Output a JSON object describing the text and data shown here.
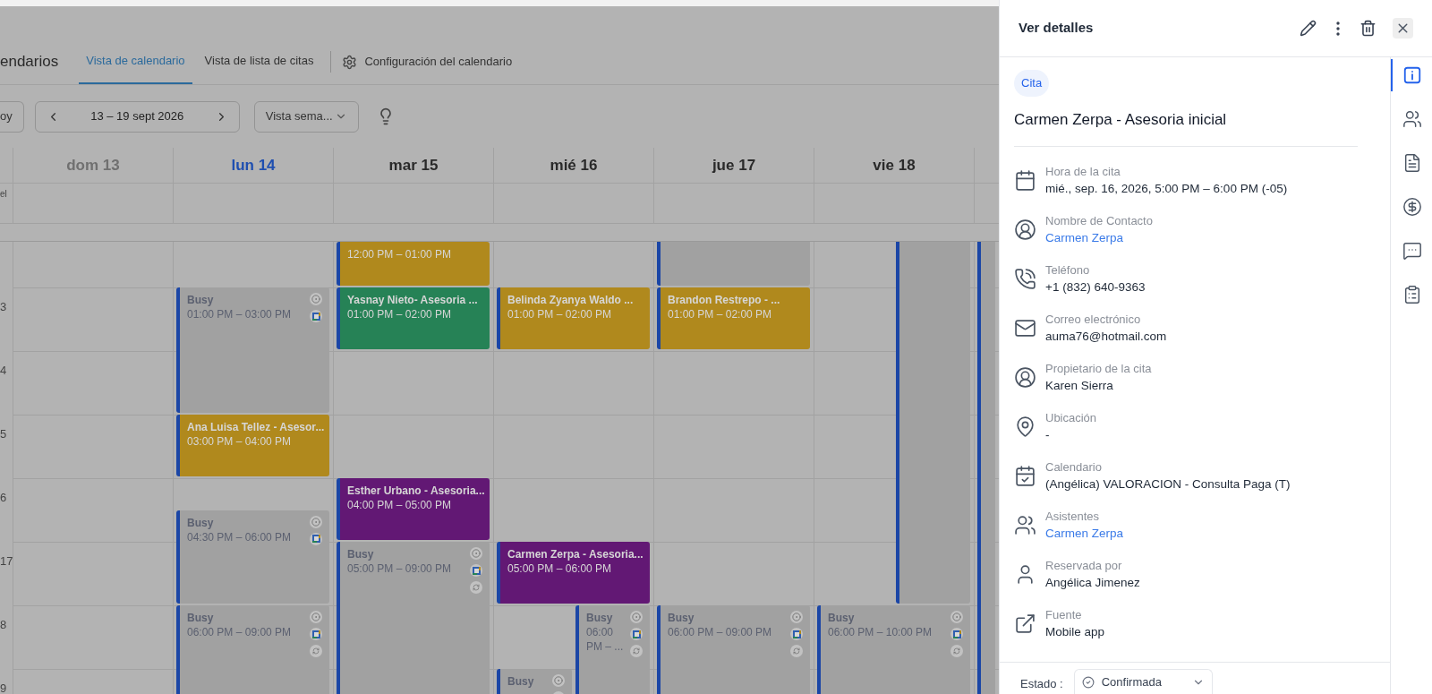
{
  "header": {
    "title": "endarios",
    "tabs": [
      {
        "label": "Vista de calendario",
        "selected": true
      },
      {
        "label": "Vista de lista de citas",
        "selected": false
      }
    ],
    "settings_link": "Configuración del calendario"
  },
  "toolbar": {
    "today_button": "oy",
    "date_range": "13 – 19 sept 2026",
    "view_select": "Vista sema..."
  },
  "calendar": {
    "all_day_label": "el",
    "hour_labels": [
      "3",
      "4",
      "5",
      "6",
      "17",
      "8",
      "9"
    ],
    "days": [
      {
        "label": "dom 13",
        "kind": "past"
      },
      {
        "label": "lun 14",
        "kind": "today",
        "events": [
          {
            "kind": "busy",
            "title": "Busy",
            "time": "01:00 PM – 03:00 PM",
            "recurring": false,
            "color": "#a1a1a1"
          },
          {
            "kind": "appointment",
            "title": "Ana Luisa Tellez - Asesor...",
            "time": "03:00 PM – 04:00 PM",
            "color": "#b0891d"
          },
          {
            "kind": "busy",
            "title": "Busy",
            "time": "04:30 PM – 06:00 PM",
            "recurring": false,
            "color": "#a1a1a1"
          },
          {
            "kind": "busy",
            "title": "Busy",
            "time": "06:00 PM – 09:00 PM",
            "recurring": true,
            "color": "#a1a1a1"
          }
        ]
      },
      {
        "label": "mar 15",
        "kind": "future",
        "events": [
          {
            "kind": "appointment",
            "time": "12:00 PM – 01:00 PM",
            "color": "#b0891d"
          },
          {
            "kind": "appointment",
            "title": "Yasnay Nieto- Asesoria ...",
            "time": "01:00 PM – 02:00 PM",
            "color": "#268256"
          },
          {
            "kind": "appointment",
            "title": "Esther Urbano - Asesoria...",
            "time": "04:00 PM – 05:00 PM",
            "color": "#621874"
          },
          {
            "kind": "busy",
            "title": "Busy",
            "time": "05:00 PM – 09:00 PM",
            "recurring": true,
            "color": "#a1a1a1"
          }
        ]
      },
      {
        "label": "mié 16",
        "kind": "future",
        "events": [
          {
            "kind": "appointment",
            "title": "Belinda Zyanya Waldo ...",
            "time": "01:00 PM – 02:00 PM",
            "color": "#b0891d"
          },
          {
            "kind": "appointment",
            "title": "Carmen Zerpa - Asesoria...",
            "time": "05:00 PM – 06:00 PM",
            "color": "#621874"
          },
          {
            "kind": "busy",
            "title": "Busy",
            "time": "06:00 PM – ...",
            "recurring": true,
            "color": "#a1a1a1"
          },
          {
            "kind": "busy",
            "title": "Busy",
            "color": "#a1a1a1"
          }
        ]
      },
      {
        "label": "jue 17",
        "kind": "future",
        "events": [
          {
            "kind": "busy",
            "color": "#a1a1a1"
          },
          {
            "kind": "appointment",
            "title": "Brandon Restrepo - ...",
            "time": "01:00 PM – 02:00 PM",
            "color": "#b0891d"
          },
          {
            "kind": "busy",
            "title": "Busy",
            "time": "06:00 PM – 09:00 PM",
            "recurring": true,
            "color": "#a1a1a1"
          }
        ]
      },
      {
        "label": "vie 18",
        "kind": "future",
        "events": [
          {
            "kind": "busy",
            "color": "#a1a1a1"
          },
          {
            "kind": "busy",
            "title": "Busy",
            "time": "06:00 PM – 10:00 PM",
            "recurring": true,
            "color": "#a1a1a1"
          }
        ]
      },
      {
        "events": [
          {
            "kind": "busy",
            "color": "#a1a1a1"
          }
        ]
      }
    ]
  },
  "details": {
    "title": "Ver detalles",
    "badge": "Cita",
    "heading": "Carmen Zerpa - Asesoria inicial",
    "fields": [
      {
        "kind": "time",
        "label": "Hora de la cita",
        "value": "mié., sep. 16, 2026, 5:00 PM – 6:00 PM (-05)",
        "link": false
      },
      {
        "kind": "contact",
        "label": "Nombre de Contacto",
        "value": "Carmen Zerpa",
        "link": true
      },
      {
        "kind": "phone",
        "label": "Teléfono",
        "value": "+1 (832) 640-9363",
        "link": false
      },
      {
        "kind": "email",
        "label": "Correo electrónico",
        "value": "auma76@hotmail.com",
        "link": false
      },
      {
        "kind": "owner",
        "label": "Propietario de la cita",
        "value": "Karen Sierra",
        "link": false
      },
      {
        "kind": "location",
        "label": "Ubicación",
        "value": "-",
        "link": false
      },
      {
        "kind": "calendar",
        "label": "Calendario",
        "value": "(Angélica) VALORACION - Consulta Paga (T)",
        "link": false
      },
      {
        "kind": "attendees",
        "label": "Asistentes",
        "value": "Carmen Zerpa",
        "link": true
      },
      {
        "kind": "booked_by",
        "label": "Reservada por",
        "value": "Angélica Jimenez",
        "link": false
      },
      {
        "kind": "source",
        "label": "Fuente",
        "value": "Mobile app",
        "link": false
      }
    ],
    "status_label": "Estado :",
    "status_value": "Confirmada",
    "rail": [
      {
        "kind": "info",
        "selected": true
      },
      {
        "kind": "people",
        "selected": false
      },
      {
        "kind": "notes",
        "selected": false
      },
      {
        "kind": "payments",
        "selected": false
      },
      {
        "kind": "messages",
        "selected": false
      },
      {
        "kind": "tasks",
        "selected": false
      }
    ]
  }
}
